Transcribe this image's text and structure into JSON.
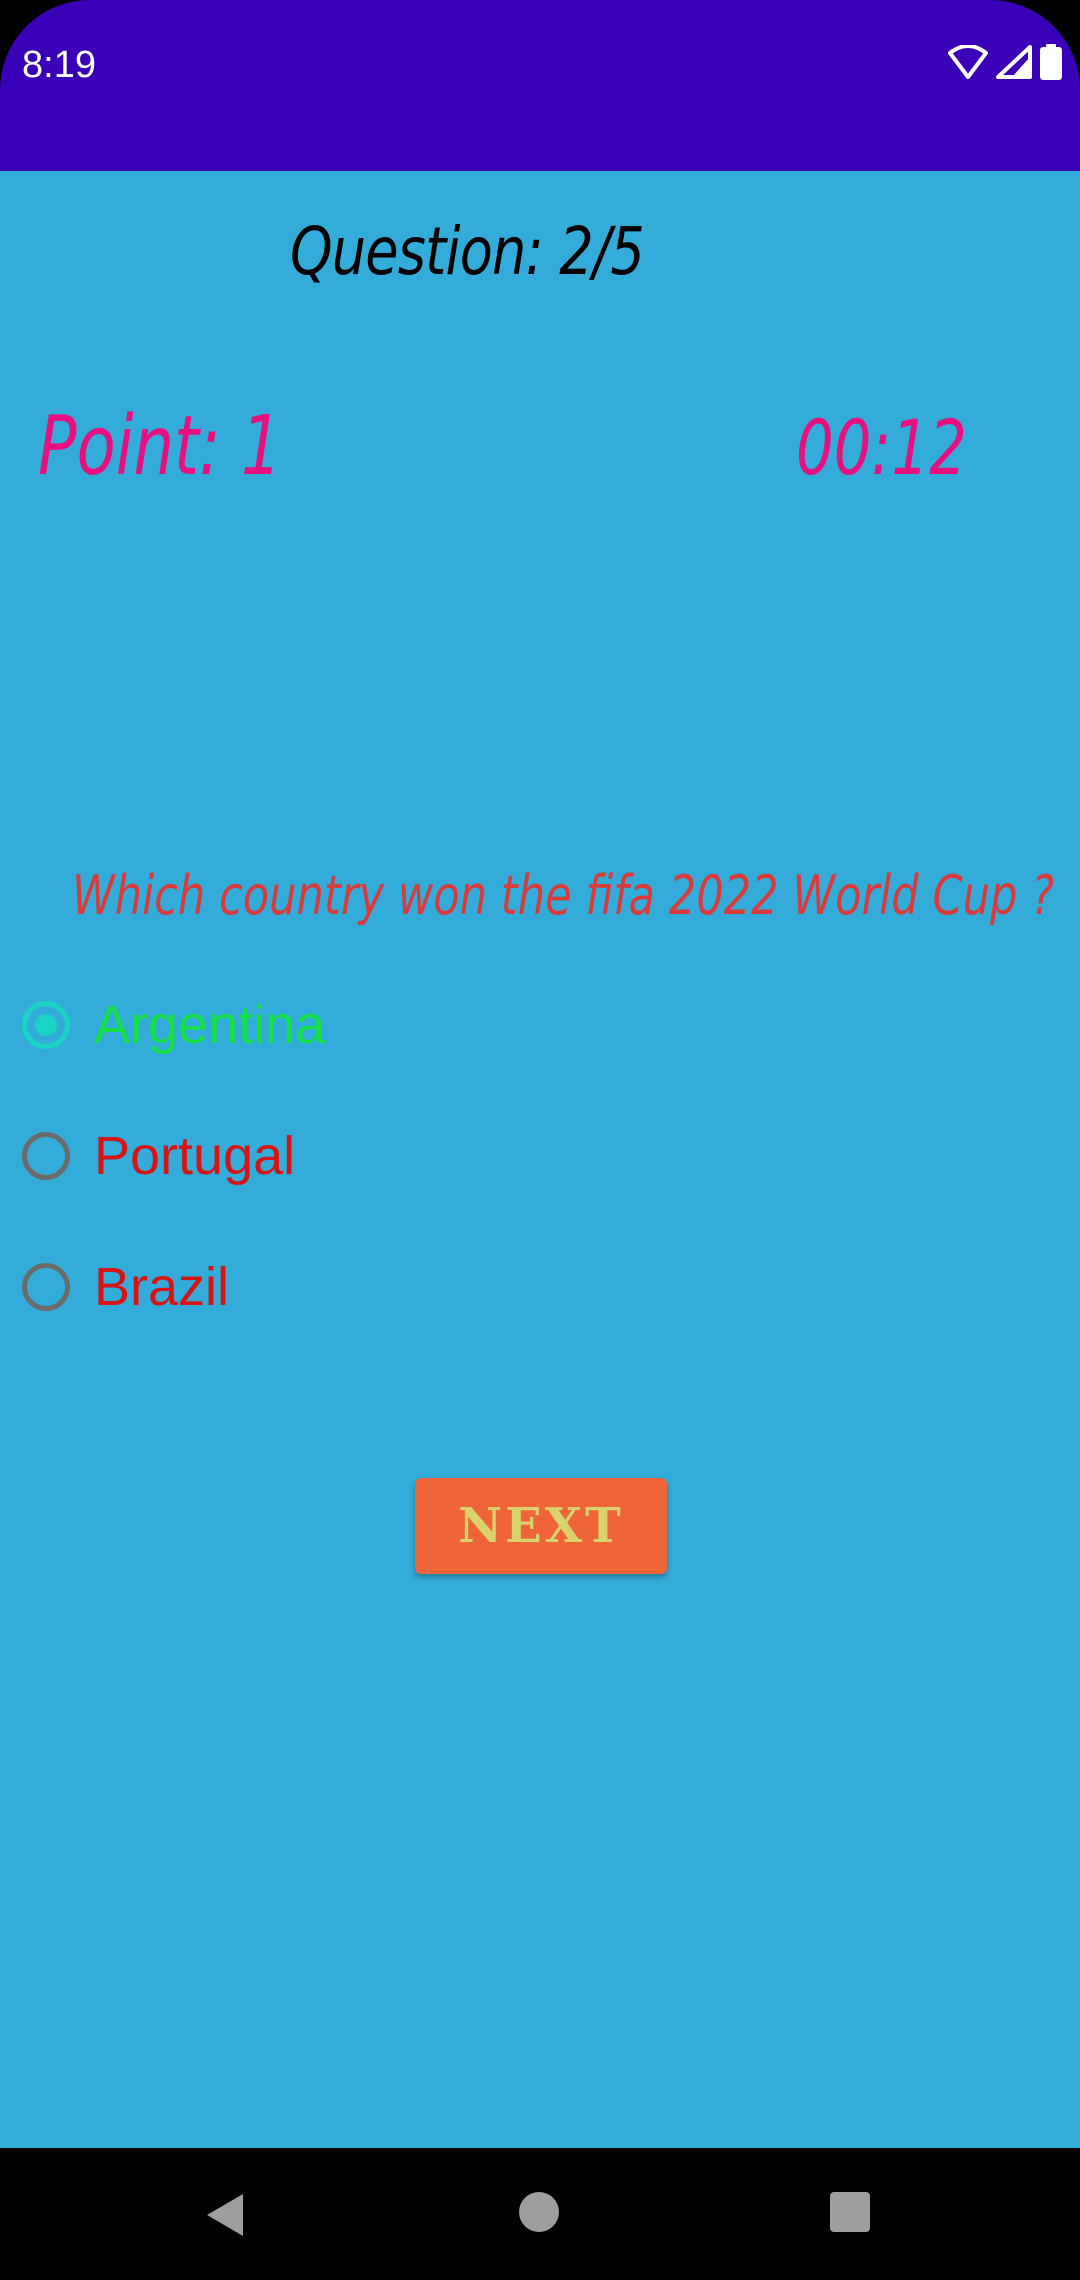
{
  "status_bar": {
    "time": "8:19",
    "icons": [
      "wifi-icon",
      "signal-icon",
      "battery-icon"
    ],
    "color": "#3a00b8"
  },
  "quiz": {
    "question_counter": "Question: 2/5",
    "points": "Point: 1",
    "timer": "00:12",
    "question": "Which country won the fifa 2022 World Cup ?",
    "options": [
      {
        "label": "Argentina",
        "selected": true
      },
      {
        "label": "Portugal",
        "selected": false
      },
      {
        "label": "Brazil",
        "selected": false
      }
    ],
    "next_label": "NEXT",
    "background_color": "#33acd9",
    "accent_pink": "#e8107e",
    "option_color": "#d71414",
    "selected_option_color": "#18e04a",
    "button_color": "#f0643a"
  },
  "nav_bar": {
    "icons": [
      "back-icon",
      "home-icon",
      "recents-icon"
    ]
  }
}
